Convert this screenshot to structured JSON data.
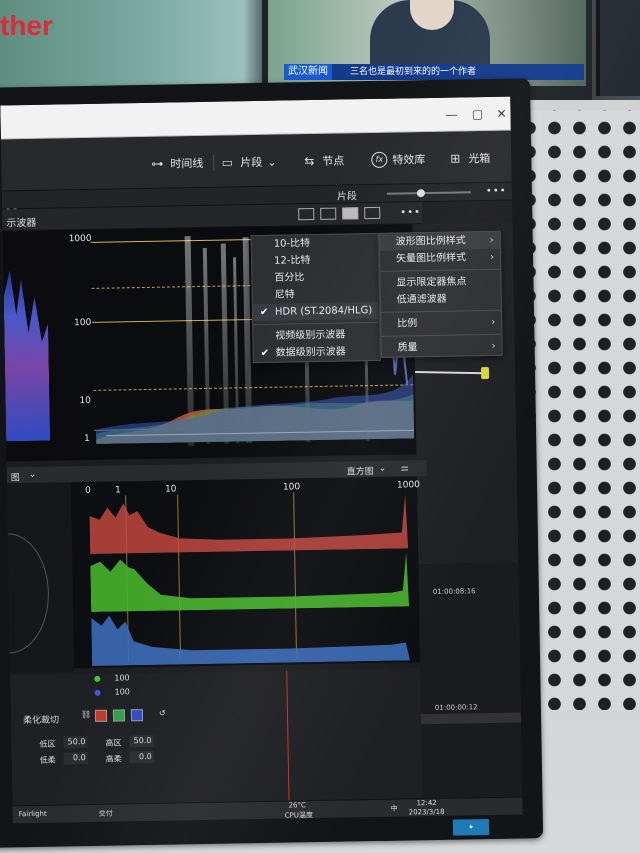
{
  "background": {
    "tv_tag": "武汉新闻",
    "tv_headline": "三名也是最初到来的的一个作者"
  },
  "app": {
    "toolbar": {
      "timeline": "时间线",
      "clip": "片段",
      "nodes": "节点",
      "effects": "特效库",
      "lightbox": "光箱"
    },
    "clip_label": "片段",
    "more": "•••",
    "scope_title": "示波器"
  },
  "scope": {
    "y_labels": [
      "1000",
      "100",
      "10",
      "1"
    ]
  },
  "submenu": {
    "items": [
      {
        "label": "10-比特",
        "checked": false
      },
      {
        "label": "12-比特",
        "checked": false
      },
      {
        "label": "百分比",
        "checked": false
      },
      {
        "label": "尼特",
        "checked": false
      },
      {
        "label": "HDR (ST.2084/HLG)",
        "checked": true
      },
      {
        "label": "视频级别示波器",
        "checked": false
      },
      {
        "label": "数据级别示波器",
        "checked": true
      }
    ]
  },
  "context_menu": {
    "items": [
      {
        "label": "波形图比例样式",
        "submenu": true
      },
      {
        "label": "矢量图比例样式",
        "submenu": true
      },
      {
        "label": "显示限定器焦点",
        "submenu": false
      },
      {
        "label": "低通滤波器",
        "submenu": false
      },
      {
        "label": "比例",
        "submenu": true
      },
      {
        "label": "质量",
        "submenu": true
      }
    ]
  },
  "histogram": {
    "left_label": "图",
    "title": "直方图",
    "ticks": [
      "0",
      "1",
      "10",
      "100",
      "1000"
    ]
  },
  "controls": {
    "values_100": [
      "100",
      "100"
    ],
    "section_label": "柔化裁切",
    "fields": [
      {
        "label": "低区",
        "value": "50.0"
      },
      {
        "label": "高区",
        "value": "50.0"
      },
      {
        "label": "低柔",
        "value": "0.0"
      },
      {
        "label": "高柔",
        "value": "0.0"
      }
    ]
  },
  "timeline": {
    "tc1": "01:00:08:16",
    "tc2": "01:00:00:12"
  },
  "taskbar": {
    "left1": "Fairlight",
    "left2": "交付",
    "temp": "26°C",
    "cpu": "CPU温度",
    "ime": "中",
    "time": "12:42",
    "date": "2023/3/18"
  },
  "colors": {
    "menu_bg": "#2e2f33",
    "scope_bg": "#0b0c0f",
    "hist_red": "#c2473f",
    "hist_green": "#47b52c",
    "hist_blue": "#3c6bb8",
    "playhead": "#d0302a",
    "tv_banner": "#133b8c"
  }
}
